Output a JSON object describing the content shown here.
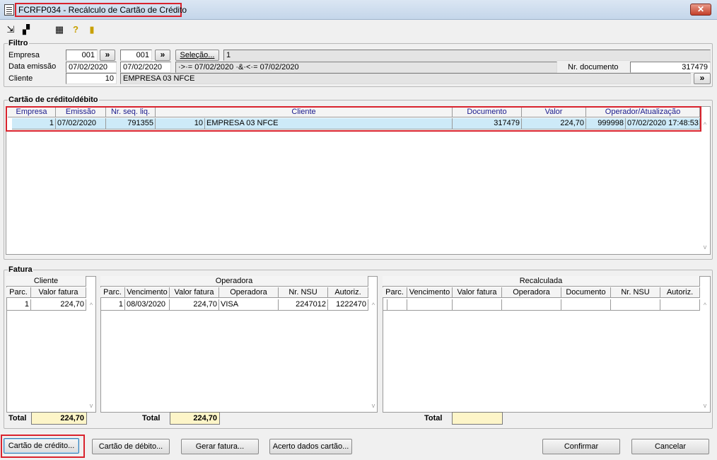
{
  "window": {
    "title": "FCRFP034 - Recálculo de Cartão de Crédito",
    "close_label": "✕"
  },
  "toolbar": {
    "icons": [
      "arrow-icon",
      "copy-icon",
      "calendar-icon",
      "help-icon",
      "exit-door-icon"
    ]
  },
  "filtro": {
    "title": "Filtro",
    "empresa_label": "Empresa",
    "empresa_from": "001",
    "empresa_to": "001",
    "more_label": "»",
    "selecao_label": "Seleção...",
    "selecao_value": "1",
    "data_label": "Data emissão",
    "data_from": "07/02/2020",
    "data_to": "07/02/2020",
    "data_expr": "·>·= 07/02/2020 ·&·<·= 07/02/2020",
    "nrdoc_label": "Nr. documento",
    "nrdoc_value": "317479",
    "cliente_label": "Cliente",
    "cliente_value": "10",
    "cliente_name": "EMPRESA 03 NFCE"
  },
  "cartao": {
    "title": "Cartão de crédito/débito",
    "columns": [
      "Empresa",
      "Emissão",
      "Nr. seq. liq.",
      "Cliente",
      "Documento",
      "Valor",
      "Operador/Atualização"
    ],
    "row": {
      "empresa": "1",
      "emissao": "07/02/2020",
      "seq": "791355",
      "cliente_cod": "10",
      "cliente_nome": "EMPRESA 03 NFCE",
      "documento": "317479",
      "valor": "224,70",
      "operador": "999998",
      "atualizacao": "07/02/2020 17:48:53"
    }
  },
  "fatura": {
    "title": "Fatura",
    "cliente": {
      "title": "Cliente",
      "columns": [
        "Parc.",
        "Valor fatura"
      ],
      "row": {
        "parc": "1",
        "valor": "224,70"
      },
      "total_label": "Total",
      "total": "224,70"
    },
    "operadora": {
      "title": "Operadora",
      "columns": [
        "Parc.",
        "Vencimento",
        "Valor fatura",
        "Operadora",
        "Nr. NSU",
        "Autoriz."
      ],
      "row": {
        "parc": "1",
        "vencimento": "08/03/2020",
        "valor": "224,70",
        "operadora": "VISA",
        "nsu": "2247012",
        "autoriz": "1222470"
      },
      "total_label": "Total",
      "total": "224,70"
    },
    "recalculada": {
      "title": "Recalculada",
      "columns": [
        "Parc.",
        "Vencimento",
        "Valor fatura",
        "Operadora",
        "Documento",
        "Nr. NSU",
        "Autoriz."
      ],
      "total_label": "Total",
      "total": ""
    }
  },
  "buttons": {
    "cartao_credito": "Cartão de crédito...",
    "cartao_debito": "Cartão de débito...",
    "gerar_fatura": "Gerar fatura...",
    "acerto": "Acerto dados cartão...",
    "confirmar": "Confirmar",
    "cancelar": "Cancelar"
  }
}
